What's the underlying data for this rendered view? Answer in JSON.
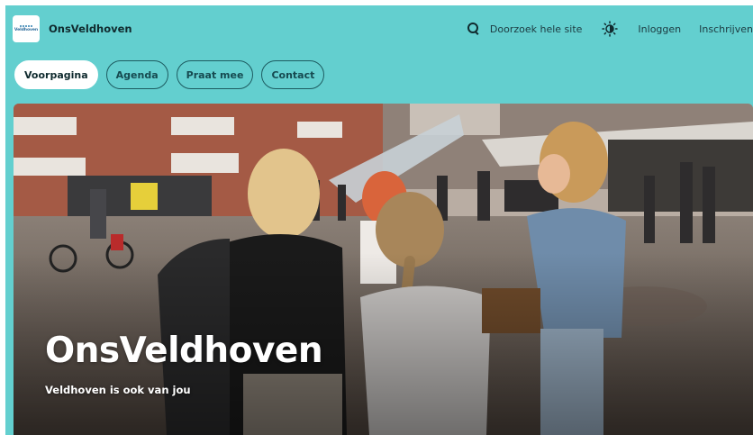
{
  "header": {
    "site_name": "OnsVeldhoven",
    "logo_text": "Veldhoven",
    "search_label": "Doorzoek hele site",
    "login_label": "Inloggen",
    "register_label": "Inschrijven"
  },
  "nav": {
    "pills": [
      {
        "label": "Voorpagina",
        "active": true
      },
      {
        "label": "Agenda",
        "active": false
      },
      {
        "label": "Praat mee",
        "active": false
      },
      {
        "label": "Contact",
        "active": false
      }
    ]
  },
  "hero": {
    "title": "OnsVeldhoven",
    "subtitle": "Veldhoven is ook van jou"
  },
  "colors": {
    "brand_bg": "#63cfcf",
    "text_dark": "#102a2e"
  },
  "icons": [
    "search-icon",
    "sun-theme-icon"
  ]
}
